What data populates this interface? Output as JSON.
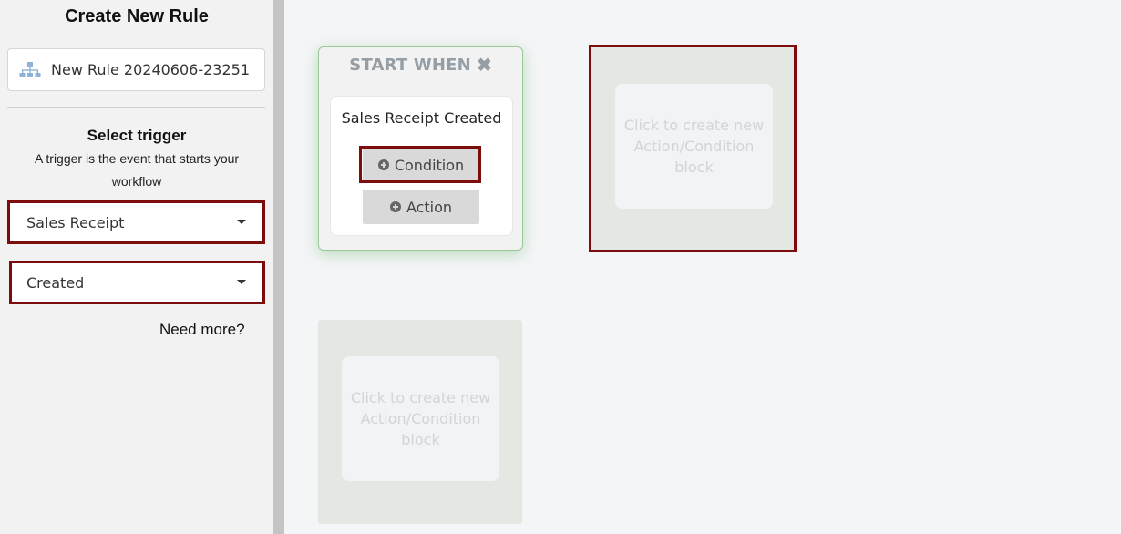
{
  "sidebar": {
    "title": "Create New Rule",
    "rule_name": "New Rule 20240606-23251",
    "rule_icon": "sitemap-icon",
    "trigger_title": "Select trigger",
    "trigger_description": "A trigger is the event that starts your workflow",
    "entity_select": "Sales Receipt",
    "event_select": "Created",
    "need_more": "Need more?"
  },
  "canvas": {
    "start_block": {
      "title": "START WHEN",
      "close_icon": "close-icon",
      "trigger_label": "Sales Receipt Created",
      "condition_button": "Condition",
      "action_button": "Action"
    },
    "placeholder_text": "Click to create new Action/Condition block"
  },
  "colors": {
    "highlight": "#7d0d0d",
    "start_glow": "#9bc99a",
    "placeholder_bg": "#e3e8e3"
  }
}
